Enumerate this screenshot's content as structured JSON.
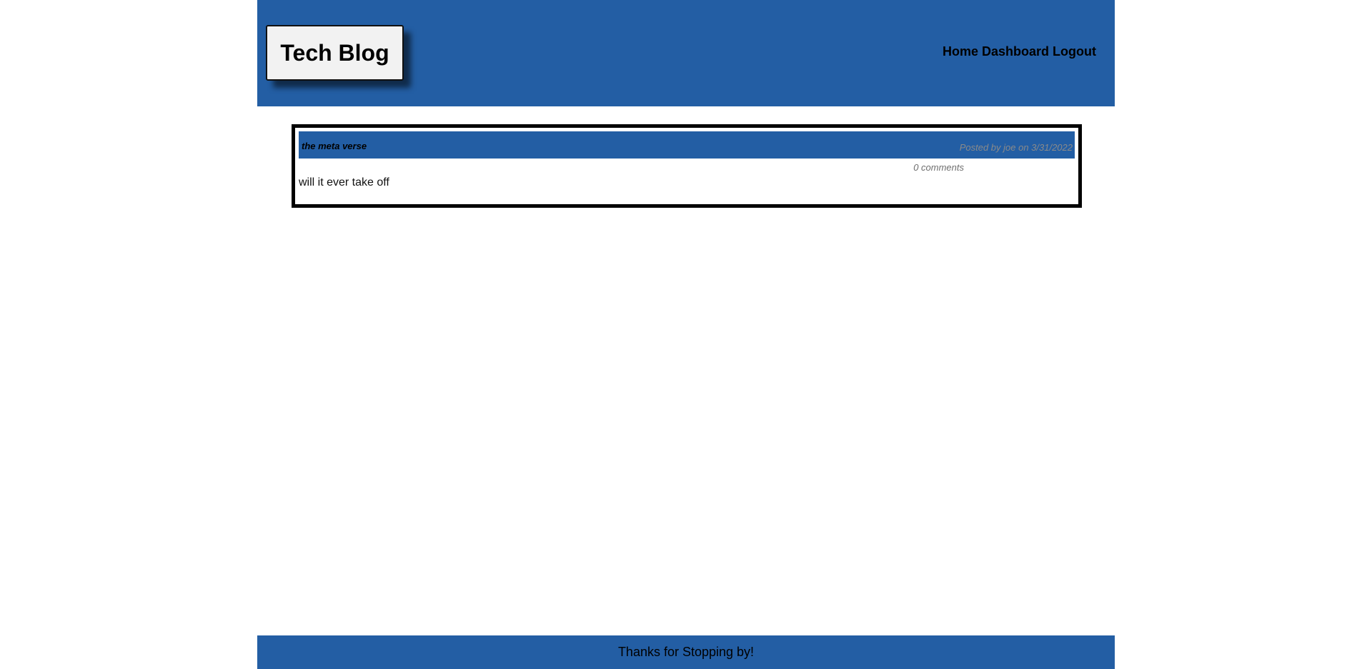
{
  "header": {
    "logo_text": "Tech Blog",
    "nav": {
      "home": "Home",
      "dashboard": "Dashboard",
      "logout": "Logout"
    }
  },
  "posts": [
    {
      "title": "the meta verse",
      "meta": "Posted by joe on 3/31/2022",
      "comments": "0 comments",
      "body": "will it ever take off"
    }
  ],
  "footer": {
    "text": "Thanks for Stopping by!"
  },
  "colors": {
    "brand_blue": "#235ea4",
    "logo_bg": "#f2f2f2",
    "meta_gray": "#8a8a8a"
  }
}
